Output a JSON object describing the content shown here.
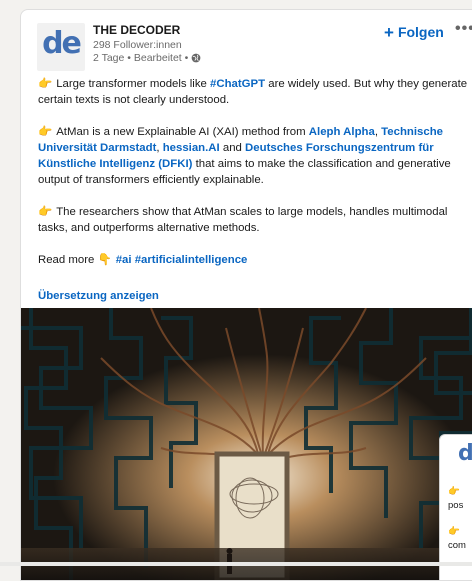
{
  "post": {
    "author": "THE DECODER",
    "logo_text": "de",
    "followers": "298 Follower:innen",
    "meta": "2 Tage • Bearbeitet •",
    "follow_label": "Folgen",
    "more_label": "•••",
    "paragraphs": [
      {
        "segments": [
          {
            "text": "Large transformer models like "
          },
          {
            "text": "#ChatGPT",
            "link": true
          },
          {
            "text": " are widely used. But why they generate certain texts is not clearly understood."
          }
        ]
      },
      {
        "segments": [
          {
            "text": "AtMan is a new Explainable AI (XAI) method from "
          },
          {
            "text": "Aleph Alpha",
            "link": true
          },
          {
            "text": ", "
          },
          {
            "text": "Technische Universität Darmstadt",
            "link": true
          },
          {
            "text": ", "
          },
          {
            "text": "hessian.AI",
            "link": true
          },
          {
            "text": " and "
          },
          {
            "text": "Deutsches Forschungszentrum für Künstliche Intelligenz (DFKI)",
            "link": true
          },
          {
            "text": " that aims to make the classification and generative output of transformers efficiently explainable."
          }
        ]
      },
      {
        "segments": [
          {
            "text": "The researchers show that AtMan scales to large models, handles multimodal tasks, and outperforms alternative methods."
          }
        ]
      }
    ],
    "read_more": {
      "label": "Read more",
      "tags": [
        "#ai",
        "#artificialintelligence"
      ]
    },
    "translate_label": "Übersetzung anzeigen"
  },
  "inset": {
    "logo_text": "d",
    "line1": "pos",
    "line2": "com"
  },
  "icons": {
    "pointing": "backhand-index-pointing-right",
    "globe": "globe-icon"
  },
  "colors": {
    "link": "#0a66c2",
    "emoji": "#f2a33a",
    "logo": "#4270b3"
  }
}
